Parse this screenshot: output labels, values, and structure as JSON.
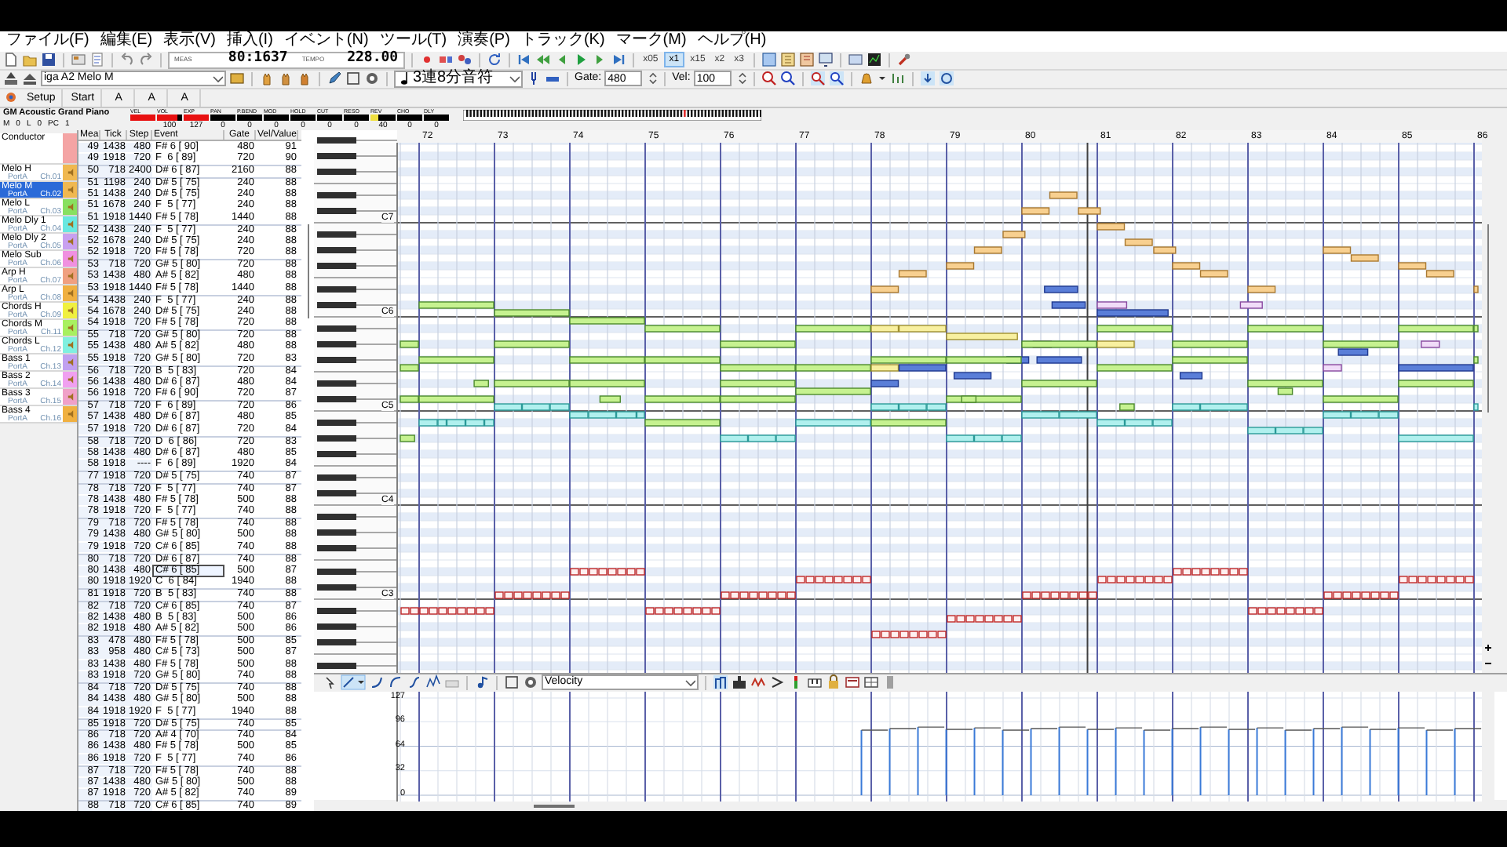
{
  "menu": [
    "ファイル(F)",
    "編集(E)",
    "表示(V)",
    "挿入(I)",
    "イベント(N)",
    "ツール(T)",
    "演奏(P)",
    "トラック(K)",
    "マーク(M)",
    "ヘルプ(H)"
  ],
  "transport": {
    "meas_label": "MEAS",
    "meas": "80:1637",
    "tempo_label": "TEMPO",
    "tempo": "228.00",
    "speeds": [
      {
        "label": "x05",
        "selected": false
      },
      {
        "label": "x1",
        "selected": true
      },
      {
        "label": "x15",
        "selected": false
      },
      {
        "label": "x2",
        "selected": false
      },
      {
        "label": "x3",
        "selected": false
      }
    ]
  },
  "edit_bar": {
    "track": "iga A2 Melo M",
    "note_length": "3連8分音符",
    "gate_label": "Gate:",
    "gate": "480",
    "vel_label": "Vel:",
    "vel": "100"
  },
  "marker_buttons": [
    "Setup",
    "Start",
    "A",
    "A",
    "A"
  ],
  "instrument": {
    "name": "GM Acoustic Grand Piano",
    "channel_items": [
      "M",
      "0",
      "L",
      "0",
      "PC",
      "1"
    ],
    "controls": [
      {
        "label": "VEL",
        "level": 1
      },
      {
        "label": "VOL",
        "level": 0.79,
        "value": "100"
      },
      {
        "label": "EXP",
        "level": 1,
        "value": "127"
      },
      {
        "label": "PAN",
        "level": 0,
        "value": "0"
      },
      {
        "label": "P.BEND",
        "level": 0,
        "value": "0"
      },
      {
        "label": "MOD",
        "level": 0,
        "value": "0"
      },
      {
        "label": "HOLD",
        "level": 0,
        "value": "0"
      },
      {
        "label": "CUT",
        "level": 0,
        "value": "0"
      },
      {
        "label": "RESO",
        "level": 0,
        "value": "0"
      },
      {
        "label": "REV",
        "level": 0.31,
        "value": "40"
      },
      {
        "label": "CHO",
        "level": 0,
        "value": "0"
      },
      {
        "label": "DLY",
        "level": 0,
        "value": "0"
      }
    ]
  },
  "tracks": [
    {
      "name": "Conductor",
      "color": "#f4a4a4",
      "selected": false
    },
    {
      "name": "Melo H",
      "port": "PortA",
      "channel": "Ch.01",
      "color": "#f0b850",
      "selected": false
    },
    {
      "name": "Melo M",
      "port": "PortA",
      "channel": "Ch.02",
      "color": "#f0b850",
      "selected": true
    },
    {
      "name": "Melo L",
      "port": "PortA",
      "channel": "Ch.03",
      "color": "#88e060",
      "selected": false
    },
    {
      "name": "Melo Dly 1",
      "port": "PortA",
      "channel": "Ch.04",
      "color": "#68e8e0",
      "selected": false
    },
    {
      "name": "Melo Dly 2",
      "port": "PortA",
      "channel": "Ch.05",
      "color": "#c8a0f0",
      "selected": false
    },
    {
      "name": "Melo Sub",
      "port": "PortA",
      "channel": "Ch.06",
      "color": "#f090e0",
      "selected": false
    },
    {
      "name": "Arp H",
      "port": "PortA",
      "channel": "Ch.07",
      "color": "#f0a080",
      "selected": false
    },
    {
      "name": "Arp L",
      "port": "PortA",
      "channel": "Ch.08",
      "color": "#f0b040",
      "selected": false
    },
    {
      "name": "Chords H",
      "port": "PortA",
      "channel": "Ch.09",
      "color": "#f0f040",
      "selected": false
    },
    {
      "name": "Chords M",
      "port": "PortA",
      "channel": "Ch.11",
      "color": "#a8f060",
      "selected": false
    },
    {
      "name": "Chords L",
      "port": "PortA",
      "channel": "Ch.12",
      "color": "#80f0e0",
      "selected": false
    },
    {
      "name": "Bass 1",
      "port": "PortA",
      "channel": "Ch.13",
      "color": "#c0a0f0",
      "selected": false
    },
    {
      "name": "Bass 2",
      "port": "PortA",
      "channel": "Ch.14",
      "color": "#f0a0f0",
      "selected": false
    },
    {
      "name": "Bass 3",
      "port": "PortA",
      "channel": "Ch.15",
      "color": "#f0a0c8",
      "selected": false
    },
    {
      "name": "Bass 4",
      "port": "PortA",
      "channel": "Ch.16",
      "color": "#f0b040",
      "selected": false
    }
  ],
  "event_list": {
    "columns": [
      "Mea",
      "Tick",
      "Step",
      "Event",
      "Gate",
      "Vel/Value"
    ],
    "rows": [
      {
        "mea": "49",
        "tick": "1438",
        "step": "480",
        "event": "F# 6 [ 90]",
        "gate": "480",
        "vel": "91",
        "selected": false
      },
      {
        "mea": "49",
        "tick": "1918",
        "step": "720",
        "event": "F  6 [ 89]",
        "gate": "720",
        "vel": "90",
        "selected": false
      },
      {
        "mea": "50",
        "tick": "718",
        "step": "2400",
        "event": "D# 6 [ 87]",
        "gate": "2160",
        "vel": "88",
        "selected": false
      },
      {
        "mea": "51",
        "tick": "1198",
        "step": "240",
        "event": "D# 5 [ 75]",
        "gate": "240",
        "vel": "88",
        "selected": false
      },
      {
        "mea": "51",
        "tick": "1438",
        "step": "240",
        "event": "D# 5 [ 75]",
        "gate": "240",
        "vel": "88",
        "selected": false
      },
      {
        "mea": "51",
        "tick": "1678",
        "step": "240",
        "event": "F  5 [ 77]",
        "gate": "240",
        "vel": "88",
        "selected": false
      },
      {
        "mea": "51",
        "tick": "1918",
        "step": "1440",
        "event": "F# 5 [ 78]",
        "gate": "1440",
        "vel": "88",
        "selected": false
      },
      {
        "mea": "52",
        "tick": "1438",
        "step": "240",
        "event": "F  5 [ 77]",
        "gate": "240",
        "vel": "88",
        "selected": false
      },
      {
        "mea": "52",
        "tick": "1678",
        "step": "240",
        "event": "D# 5 [ 75]",
        "gate": "240",
        "vel": "88",
        "selected": false
      },
      {
        "mea": "52",
        "tick": "1918",
        "step": "720",
        "event": "F# 5 [ 78]",
        "gate": "720",
        "vel": "88",
        "selected": false
      },
      {
        "mea": "53",
        "tick": "718",
        "step": "720",
        "event": "G# 5 [ 80]",
        "gate": "720",
        "vel": "88",
        "selected": false
      },
      {
        "mea": "53",
        "tick": "1438",
        "step": "480",
        "event": "A# 5 [ 82]",
        "gate": "480",
        "vel": "88",
        "selected": false
      },
      {
        "mea": "53",
        "tick": "1918",
        "step": "1440",
        "event": "F# 5 [ 78]",
        "gate": "1440",
        "vel": "88",
        "selected": false
      },
      {
        "mea": "54",
        "tick": "1438",
        "step": "240",
        "event": "F  5 [ 77]",
        "gate": "240",
        "vel": "88",
        "selected": false
      },
      {
        "mea": "54",
        "tick": "1678",
        "step": "240",
        "event": "D# 5 [ 75]",
        "gate": "240",
        "vel": "88",
        "selected": false
      },
      {
        "mea": "54",
        "tick": "1918",
        "step": "720",
        "event": "F# 5 [ 78]",
        "gate": "720",
        "vel": "88",
        "selected": false
      },
      {
        "mea": "55",
        "tick": "718",
        "step": "720",
        "event": "G# 5 [ 80]",
        "gate": "720",
        "vel": "88",
        "selected": false
      },
      {
        "mea": "55",
        "tick": "1438",
        "step": "480",
        "event": "A# 5 [ 82]",
        "gate": "480",
        "vel": "88",
        "selected": false
      },
      {
        "mea": "55",
        "tick": "1918",
        "step": "720",
        "event": "G# 5 [ 80]",
        "gate": "720",
        "vel": "83",
        "selected": false
      },
      {
        "mea": "56",
        "tick": "718",
        "step": "720",
        "event": "B  5 [ 83]",
        "gate": "720",
        "vel": "84",
        "selected": false
      },
      {
        "mea": "56",
        "tick": "1438",
        "step": "480",
        "event": "D# 6 [ 87]",
        "gate": "480",
        "vel": "84",
        "selected": false
      },
      {
        "mea": "56",
        "tick": "1918",
        "step": "720",
        "event": "F# 6 [ 90]",
        "gate": "720",
        "vel": "87",
        "selected": false
      },
      {
        "mea": "57",
        "tick": "718",
        "step": "720",
        "event": "F  6 [ 89]",
        "gate": "720",
        "vel": "86",
        "selected": false
      },
      {
        "mea": "57",
        "tick": "1438",
        "step": "480",
        "event": "D# 6 [ 87]",
        "gate": "480",
        "vel": "85",
        "selected": false
      },
      {
        "mea": "57",
        "tick": "1918",
        "step": "720",
        "event": "D# 6 [ 87]",
        "gate": "720",
        "vel": "84",
        "selected": false
      },
      {
        "mea": "58",
        "tick": "718",
        "step": "720",
        "event": "D  6 [ 86]",
        "gate": "720",
        "vel": "83",
        "selected": false
      },
      {
        "mea": "58",
        "tick": "1438",
        "step": "480",
        "event": "D# 6 [ 87]",
        "gate": "480",
        "vel": "85",
        "selected": false
      },
      {
        "mea": "58",
        "tick": "1918",
        "step": "----",
        "event": "F  6 [ 89]",
        "gate": "1920",
        "vel": "84",
        "selected": false
      },
      {
        "mea": "77",
        "tick": "1918",
        "step": "720",
        "event": "D# 5 [ 75]",
        "gate": "740",
        "vel": "87",
        "selected": false
      },
      {
        "mea": "78",
        "tick": "718",
        "step": "720",
        "event": "F  5 [ 77]",
        "gate": "740",
        "vel": "87",
        "selected": false
      },
      {
        "mea": "78",
        "tick": "1438",
        "step": "480",
        "event": "F# 5 [ 78]",
        "gate": "500",
        "vel": "88",
        "selected": false
      },
      {
        "mea": "78",
        "tick": "1918",
        "step": "720",
        "event": "F  5 [ 77]",
        "gate": "740",
        "vel": "88",
        "selected": false
      },
      {
        "mea": "79",
        "tick": "718",
        "step": "720",
        "event": "F# 5 [ 78]",
        "gate": "740",
        "vel": "88",
        "selected": false
      },
      {
        "mea": "79",
        "tick": "1438",
        "step": "480",
        "event": "G# 5 [ 80]",
        "gate": "500",
        "vel": "88",
        "selected": false
      },
      {
        "mea": "79",
        "tick": "1918",
        "step": "720",
        "event": "C# 6 [ 85]",
        "gate": "740",
        "vel": "88",
        "selected": false
      },
      {
        "mea": "80",
        "tick": "718",
        "step": "720",
        "event": "D# 6 [ 87]",
        "gate": "740",
        "vel": "88",
        "selected": false
      },
      {
        "mea": "80",
        "tick": "1438",
        "step": "480",
        "event": "C# 6 [ 85]",
        "gate": "500",
        "vel": "87",
        "selected": true
      },
      {
        "mea": "80",
        "tick": "1918",
        "step": "1920",
        "event": "C  6 [ 84]",
        "gate": "1940",
        "vel": "88",
        "selected": false
      },
      {
        "mea": "81",
        "tick": "1918",
        "step": "720",
        "event": "B  5 [ 83]",
        "gate": "740",
        "vel": "88",
        "selected": false
      },
      {
        "mea": "82",
        "tick": "718",
        "step": "720",
        "event": "C# 6 [ 85]",
        "gate": "740",
        "vel": "87",
        "selected": false
      },
      {
        "mea": "82",
        "tick": "1438",
        "step": "480",
        "event": "B  5 [ 83]",
        "gate": "500",
        "vel": "86",
        "selected": false
      },
      {
        "mea": "82",
        "tick": "1918",
        "step": "480",
        "event": "A# 5 [ 82]",
        "gate": "500",
        "vel": "86",
        "selected": false
      },
      {
        "mea": "83",
        "tick": "478",
        "step": "480",
        "event": "F# 5 [ 78]",
        "gate": "500",
        "vel": "85",
        "selected": false
      },
      {
        "mea": "83",
        "tick": "958",
        "step": "480",
        "event": "C# 5 [ 73]",
        "gate": "500",
        "vel": "87",
        "selected": false
      },
      {
        "mea": "83",
        "tick": "1438",
        "step": "480",
        "event": "F# 5 [ 78]",
        "gate": "500",
        "vel": "88",
        "selected": false
      },
      {
        "mea": "83",
        "tick": "1918",
        "step": "720",
        "event": "G# 5 [ 80]",
        "gate": "740",
        "vel": "88",
        "selected": false
      },
      {
        "mea": "84",
        "tick": "718",
        "step": "720",
        "event": "D# 5 [ 75]",
        "gate": "740",
        "vel": "88",
        "selected": false
      },
      {
        "mea": "84",
        "tick": "1438",
        "step": "480",
        "event": "G# 5 [ 80]",
        "gate": "500",
        "vel": "88",
        "selected": false
      },
      {
        "mea": "84",
        "tick": "1918",
        "step": "1920",
        "event": "F  5 [ 77]",
        "gate": "1940",
        "vel": "88",
        "selected": false
      },
      {
        "mea": "85",
        "tick": "1918",
        "step": "720",
        "event": "D# 5 [ 75]",
        "gate": "740",
        "vel": "85",
        "selected": false
      },
      {
        "mea": "86",
        "tick": "718",
        "step": "720",
        "event": "A# 4 [ 70]",
        "gate": "740",
        "vel": "84",
        "selected": false
      },
      {
        "mea": "86",
        "tick": "1438",
        "step": "480",
        "event": "F# 5 [ 78]",
        "gate": "500",
        "vel": "85",
        "selected": false
      },
      {
        "mea": "86",
        "tick": "1918",
        "step": "720",
        "event": "F  5 [ 77]",
        "gate": "740",
        "vel": "86",
        "selected": false
      },
      {
        "mea": "87",
        "tick": "718",
        "step": "720",
        "event": "F# 5 [ 78]",
        "gate": "740",
        "vel": "88",
        "selected": false
      },
      {
        "mea": "87",
        "tick": "1438",
        "step": "480",
        "event": "G# 5 [ 80]",
        "gate": "500",
        "vel": "88",
        "selected": false
      },
      {
        "mea": "87",
        "tick": "1918",
        "step": "720",
        "event": "A# 5 [ 82]",
        "gate": "740",
        "vel": "89",
        "selected": false
      },
      {
        "mea": "88",
        "tick": "718",
        "step": "720",
        "event": "C# 6 [ 85]",
        "gate": "740",
        "vel": "89",
        "selected": false
      }
    ]
  },
  "piano_roll": {
    "measures": [
      "72",
      "73",
      "74",
      "75",
      "76",
      "77",
      "78",
      "79",
      "80",
      "81",
      "82",
      "83",
      "84",
      "85",
      "86"
    ],
    "octaves": [
      "C7",
      "C6",
      "C5",
      "C4",
      "C3"
    ]
  },
  "velocity_lane": {
    "controller": "Velocity",
    "ticks": [
      "127",
      "96",
      "64",
      "32",
      "0"
    ]
  }
}
